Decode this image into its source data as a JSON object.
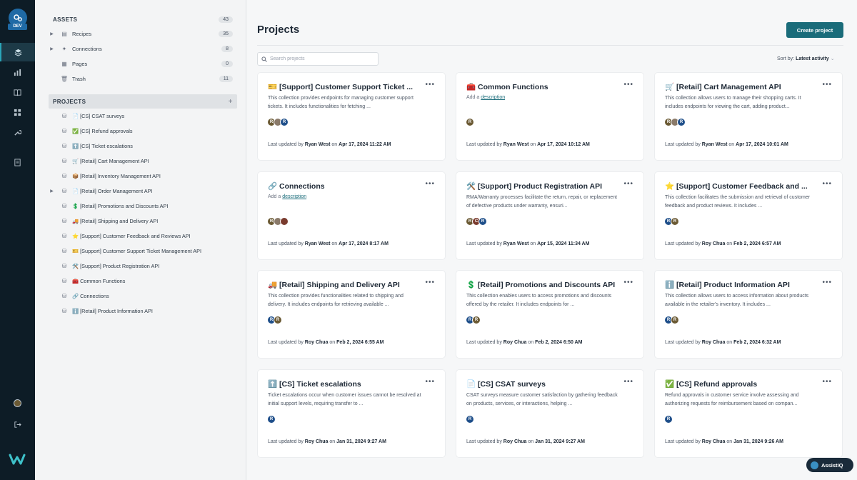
{
  "rail": {
    "badge": "DEV"
  },
  "sidebar": {
    "assets": {
      "heading": "ASSETS",
      "count": "43",
      "items": [
        {
          "label": "Recipes",
          "count": "35",
          "icon": "recipe-icon"
        },
        {
          "label": "Connections",
          "count": "8",
          "icon": "connection-icon"
        },
        {
          "label": "Pages",
          "count": "0",
          "icon": "pages-icon"
        },
        {
          "label": "Trash",
          "count": "11",
          "icon": "trash-icon"
        }
      ]
    },
    "projects": {
      "heading": "PROJECTS",
      "add": "+",
      "items": [
        {
          "label": "📄 [CS] CSAT surveys"
        },
        {
          "label": "✅ [CS] Refund approvals"
        },
        {
          "label": "⬆️ [CS] Ticket escalations"
        },
        {
          "label": "🛒 [Retail] Cart Management API"
        },
        {
          "label": "📦 [Retail] Inventory Management API"
        },
        {
          "label": "📄 [Retail] Order Management API"
        },
        {
          "label": "💲 [Retail] Promotions and Discounts API"
        },
        {
          "label": "🚚 [Retail] Shipping and Delivery API"
        },
        {
          "label": "⭐ [Support] Customer Feedback and Reviews API"
        },
        {
          "label": "🎫 [Support] Customer Support Ticket Management API"
        },
        {
          "label": "🛠️ [Support] Product Registration API"
        },
        {
          "label": "🧰 Common Functions"
        },
        {
          "label": "🔗 Connections"
        },
        {
          "label": "ℹ️ [Retail] Product Information API"
        }
      ]
    }
  },
  "main": {
    "title": "Projects",
    "create_button": "Create project",
    "search_placeholder": "Search projects",
    "sort_label": "Sort by:",
    "sort_value": "Latest activity",
    "updated_prefix": "Last updated by",
    "updated_on": "on",
    "add_prefix": "Add a",
    "add_link": "description",
    "cards": [
      {
        "title": "🎫 [Support] Customer Support Ticket ...",
        "desc": "This collection provides endpoints for managing customer support tickets. It includes functionalities for fetching ...",
        "avatars": [
          "g",
          "p",
          "b"
        ],
        "avatar_labels": [
          "R",
          "",
          "R"
        ],
        "user": "Ryan West",
        "date": "Apr 17, 2024 11:22 AM"
      },
      {
        "title": "🧰 Common Functions",
        "desc": "",
        "avatars": [
          "g"
        ],
        "avatar_labels": [
          "R"
        ],
        "user": "Ryan West",
        "date": "Apr 17, 2024 10:12 AM"
      },
      {
        "title": "🛒 [Retail] Cart Management API",
        "desc": "This collection allows users to manage their shopping carts. It includes endpoints for viewing the cart, adding product...",
        "avatars": [
          "g",
          "p",
          "b"
        ],
        "avatar_labels": [
          "R",
          "",
          "R"
        ],
        "user": "Ryan West",
        "date": "Apr 17, 2024 10:01 AM"
      },
      {
        "title": "🔗 Connections",
        "desc": "",
        "avatars": [
          "g",
          "p",
          "r"
        ],
        "avatar_labels": [
          "R",
          "",
          ""
        ],
        "user": "Ryan West",
        "date": "Apr 17, 2024 8:17 AM"
      },
      {
        "title": "🛠️ [Support] Product Registration API",
        "desc": "RMA/Warranty processes facilitate the return, repair, or replacement of defective products under warranty, ensuri...",
        "avatars": [
          "g",
          "r",
          "b"
        ],
        "avatar_labels": [
          "R",
          "C",
          "R"
        ],
        "user": "Ryan West",
        "date": "Apr 15, 2024 11:34 AM"
      },
      {
        "title": "⭐ [Support] Customer Feedback and ...",
        "desc": "This collection facilitates the submission and retrieval of customer feedback and product reviews. It includes ...",
        "avatars": [
          "b",
          "g"
        ],
        "avatar_labels": [
          "R",
          "R"
        ],
        "user": "Roy Chua",
        "date": "Feb 2, 2024 6:57 AM"
      },
      {
        "title": "🚚 [Retail] Shipping and Delivery API",
        "desc": "This collection provides functionalities related to shipping and delivery. It includes endpoints for retrieving available ...",
        "avatars": [
          "b",
          "g"
        ],
        "avatar_labels": [
          "R",
          "R"
        ],
        "user": "Roy Chua",
        "date": "Feb 2, 2024 6:55 AM"
      },
      {
        "title": "💲 [Retail] Promotions and Discounts API",
        "desc": "This collection enables users to access promotions and discounts offered by the retailer. It includes endpoints for ...",
        "avatars": [
          "b",
          "g"
        ],
        "avatar_labels": [
          "R",
          "R"
        ],
        "user": "Roy Chua",
        "date": "Feb 2, 2024 6:50 AM"
      },
      {
        "title": "ℹ️ [Retail] Product Information API",
        "desc": "This collection allows users to access information about products available in the retailer's inventory. It includes ...",
        "avatars": [
          "b",
          "g"
        ],
        "avatar_labels": [
          "R",
          "R"
        ],
        "user": "Roy Chua",
        "date": "Feb 2, 2024 6:32 AM"
      },
      {
        "title": "⬆️ [CS] Ticket escalations",
        "desc": "Ticket escalations occur when customer issues cannot be resolved at initial support levels, requiring transfer to ...",
        "avatars": [
          "b"
        ],
        "avatar_labels": [
          "R"
        ],
        "user": "Roy Chua",
        "date": "Jan 31, 2024 9:27 AM"
      },
      {
        "title": "📄 [CS] CSAT surveys",
        "desc": "CSAT surveys measure customer satisfaction by gathering feedback on products, services, or interactions, helping ...",
        "avatars": [
          "b"
        ],
        "avatar_labels": [
          "R"
        ],
        "user": "Roy Chua",
        "date": "Jan 31, 2024 9:27 AM"
      },
      {
        "title": "✅ [CS] Refund approvals",
        "desc": "Refund approvals in customer service involve assessing and authorizing requests for reimbursement based on compan...",
        "avatars": [
          "b"
        ],
        "avatar_labels": [
          "R"
        ],
        "user": "Roy Chua",
        "date": "Jan 31, 2024 9:26 AM"
      }
    ]
  },
  "assist": {
    "label": "AssistIQ"
  }
}
